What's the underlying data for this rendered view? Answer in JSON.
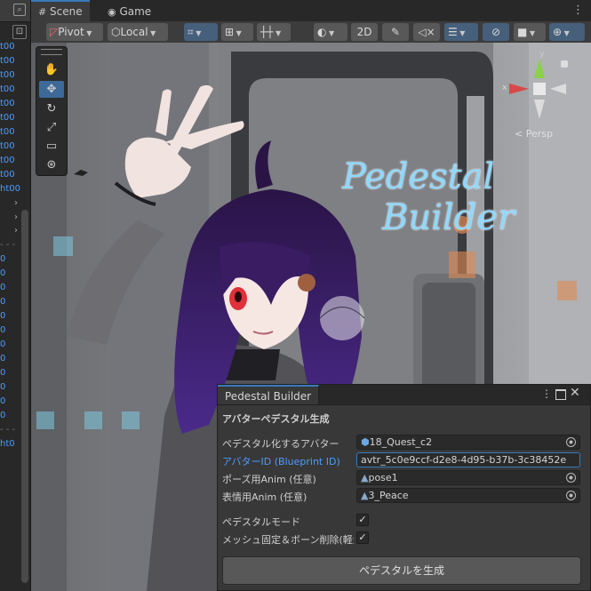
{
  "hierarchy": {
    "rows": [
      "t00",
      "t00",
      "t00",
      "t00",
      "t00",
      "t00",
      "t00",
      "t00",
      "t00",
      "t00",
      "ht00"
    ],
    "more_rows": [
      "0",
      "0",
      "0",
      "0",
      "0",
      "0",
      "0",
      "0",
      "0",
      "0",
      "0",
      "0"
    ],
    "last_row": "ht0"
  },
  "tabs": {
    "scene": "Scene",
    "game": "Game"
  },
  "toolbar": {
    "pivot": "Pivot",
    "local": "Local",
    "mode_2d": "2D"
  },
  "scene": {
    "gizmo_persp": "< Persp",
    "gizmo_x": "x",
    "gizmo_y": "y",
    "title_line1": "Pedestal",
    "title_line2": "Builder"
  },
  "panel": {
    "tab_title": "Pedestal Builder",
    "section_title": "アバターペデスタル生成",
    "fields": {
      "avatar_label": "ペデスタル化するアバター",
      "avatar_value": "18_Quest_c2",
      "avatar_id_label": "アバターID (Blueprint ID)",
      "avatar_id_value": "avtr_5c0e9ccf-d2e8-4d95-b37b-3c38452e",
      "pose_label": "ポーズ用Anim (任意)",
      "pose_value": "pose1",
      "face_label": "表情用Anim (任意)",
      "face_value": "3_Peace",
      "mode_label": "ペデスタルモード",
      "mesh_label": "メッシュ固定＆ボーン削除(軽量"
    },
    "generate_button": "ペデスタルを生成"
  },
  "colors": {
    "accent": "#3a79bb",
    "link_blue": "#4d9cff",
    "title_cyan": "#8fd8ff",
    "hair": "#3a1c63",
    "eye_red": "#e0303a"
  }
}
